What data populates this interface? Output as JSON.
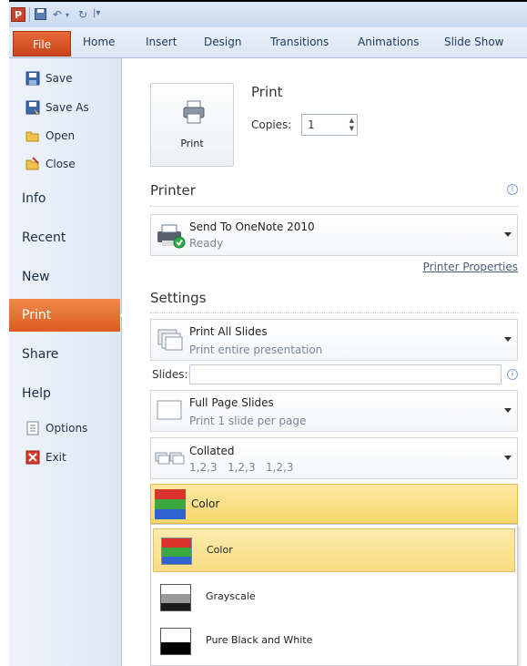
{
  "ribbon": {
    "file_tab": "File",
    "tabs": [
      "Home",
      "Insert",
      "Design",
      "Transitions",
      "Animations",
      "Slide Show"
    ]
  },
  "nav": {
    "save": "Save",
    "save_as": "Save As",
    "open": "Open",
    "close": "Close",
    "info": "Info",
    "recent": "Recent",
    "new": "New",
    "print": "Print",
    "share": "Share",
    "help": "Help",
    "options": "Options",
    "exit": "Exit"
  },
  "print": {
    "button_label": "Print",
    "heading": "Print",
    "copies_label": "Copies:",
    "copies_value": "1"
  },
  "printer": {
    "section_title": "Printer",
    "name": "Send To OneNote 2010",
    "status": "Ready",
    "properties_link": "Printer Properties"
  },
  "settings": {
    "section_title": "Settings",
    "slides_option": "Print All Slides",
    "slides_option_desc": "Print entire presentation",
    "slides_label": "Slides:",
    "slides_value": "",
    "layout_option": "Full Page Slides",
    "layout_option_desc": "Print 1 slide per page",
    "collation": "Collated",
    "collation_desc": "1,2,3   1,2,3   1,2,3",
    "color_selected": "Color",
    "color_options": [
      "Color",
      "Grayscale",
      "Pure Black and White"
    ]
  },
  "colors": {
    "file_tab": "#d9531e",
    "print_selected": "#e8712f",
    "highlight": "#f9dc82"
  }
}
